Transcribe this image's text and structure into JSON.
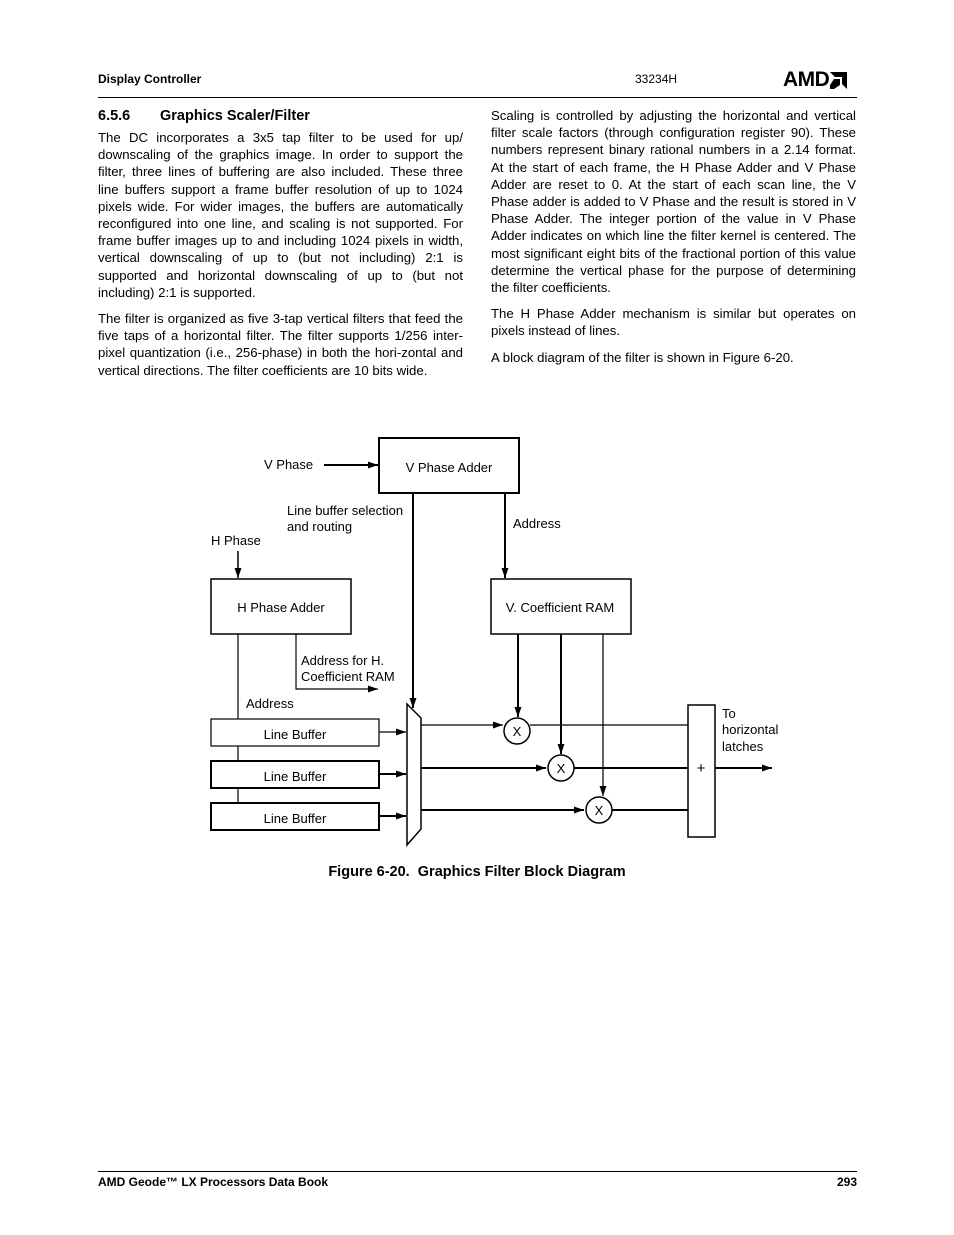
{
  "header": {
    "section": "Display Controller",
    "doc_number": "33234H",
    "logo": "AMD"
  },
  "section": {
    "number": "6.5.6",
    "title": "Graphics Scaler/Filter"
  },
  "left_column": {
    "paragraphs": [
      "The DC incorporates a 3x5 tap filter to be used for up/ downscaling of the graphics image. In order to support the filter, three lines of buffering are also included. These three line buffers support a frame buffer resolution of up to 1024 pixels wide. For wider images, the buffers are automatically reconfigured into one line, and scaling is not supported. For frame buffer images up to and including 1024 pixels in width, vertical downscaling of up to (but not including) 2:1 is supported and horizontal downscaling of up to (but not including) 2:1 is supported.",
      "The filter is organized as five 3-tap vertical filters that feed the five taps of a horizontal filter. The filter supports 1/256 inter-pixel quantization (i.e., 256-phase) in both the hori-zontal and vertical directions. The filter coefficients are 10 bits wide."
    ]
  },
  "right_column": {
    "paragraphs": [
      "Scaling is controlled by adjusting the horizontal and vertical filter scale factors (through configuration register 90). These numbers represent binary rational numbers in a 2.14 format. At the start of each frame, the H Phase Adder and V Phase Adder are reset to 0. At the start of each scan line, the V Phase adder is added to V Phase and the result is stored in V Phase Adder. The integer portion of the value in V Phase Adder indicates on which line the filter kernel is centered. The most significant eight bits of the fractional portion of this value determine the vertical phase for the purpose of determining the filter coefficients.",
      "The H Phase Adder mechanism is similar but operates on pixels instead of lines.",
      "A block diagram of the filter is shown in Figure 6-20."
    ]
  },
  "diagram": {
    "v_phase_input": "V Phase",
    "v_phase_adder": "V Phase Adder",
    "line_buffer_selection_1": "Line buffer selection",
    "line_buffer_selection_2": "and routing",
    "address_v": "Address",
    "h_phase_input": "H Phase",
    "h_phase_adder": "H Phase Adder",
    "v_coefficient_ram": "V. Coefficient RAM",
    "address_h_coeff_1": "Address for H.",
    "address_h_coeff_2": "Coefficient RAM",
    "address_h": "Address",
    "line_buffers": [
      "Line Buffer",
      "Line Buffer",
      "Line Buffer"
    ],
    "multiplier_symbol": "X",
    "adder_symbol": "+",
    "output_1": "To",
    "output_2": "horizontal",
    "output_3": "latches"
  },
  "figure": {
    "caption": "Figure 6-20.  Graphics Filter Block Diagram"
  },
  "footer": {
    "book_title": "AMD Geode™ LX Processors Data Book",
    "page_number": "293"
  }
}
